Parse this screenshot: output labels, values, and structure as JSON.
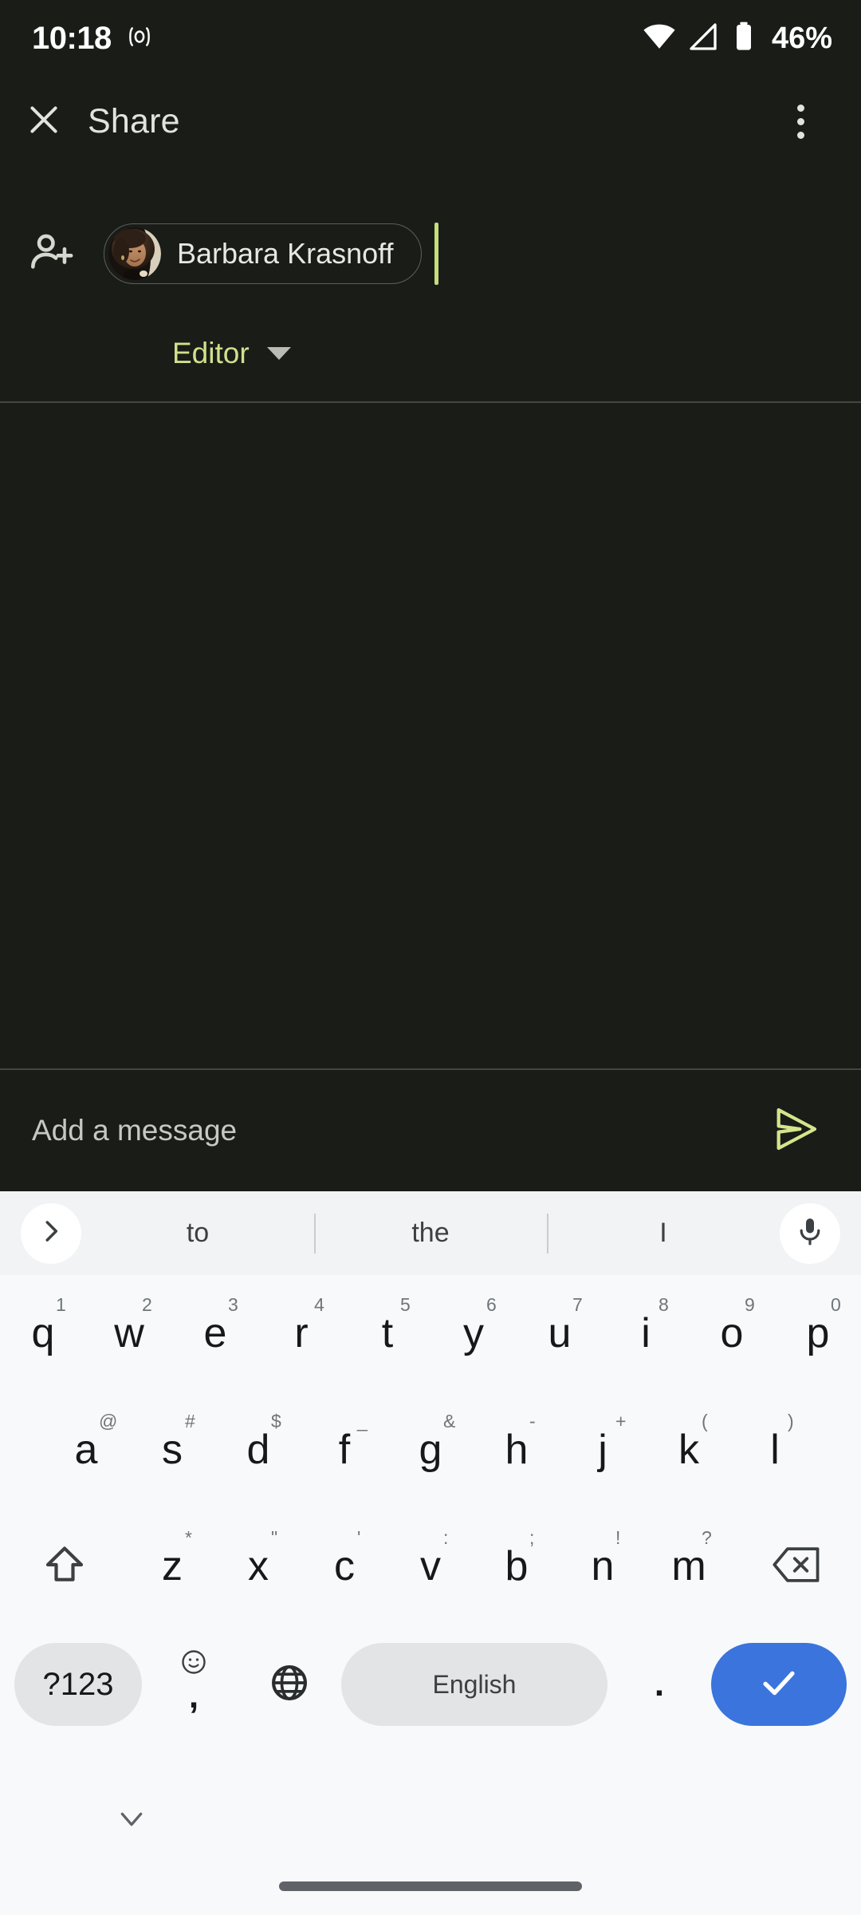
{
  "status_bar": {
    "clock": "10:18",
    "record_icon": "record-indicator-icon",
    "wifi_icon": "wifi-icon",
    "signal_icon": "cellular-signal-icon",
    "battery_icon": "battery-icon",
    "battery_percent": "46%"
  },
  "app_bar": {
    "close_icon": "close-icon",
    "title": "Share",
    "overflow_icon": "more-vert-icon"
  },
  "recipient": {
    "add_person_icon": "person-add-icon",
    "chip_name": "Barbara Krasnoff",
    "avatar_alt": "avatar",
    "caret_color": "#c6dd7c"
  },
  "role": {
    "label": "Editor",
    "caret_icon": "chevron-down-icon",
    "color": "#cfe18c"
  },
  "message": {
    "placeholder": "Add a message",
    "send_icon": "send-icon",
    "send_color": "#d4e58b"
  },
  "keyboard": {
    "expand_icon": "chevron-right-icon",
    "mic_icon": "microphone-icon",
    "suggestions": [
      "to",
      "the",
      "I"
    ],
    "row1": [
      {
        "key": "q",
        "alt": "1"
      },
      {
        "key": "w",
        "alt": "2"
      },
      {
        "key": "e",
        "alt": "3"
      },
      {
        "key": "r",
        "alt": "4"
      },
      {
        "key": "t",
        "alt": "5"
      },
      {
        "key": "y",
        "alt": "6"
      },
      {
        "key": "u",
        "alt": "7"
      },
      {
        "key": "i",
        "alt": "8"
      },
      {
        "key": "o",
        "alt": "9"
      },
      {
        "key": "p",
        "alt": "0"
      }
    ],
    "row2": [
      {
        "key": "a",
        "alt": "@"
      },
      {
        "key": "s",
        "alt": "#"
      },
      {
        "key": "d",
        "alt": "$"
      },
      {
        "key": "f",
        "alt": "_"
      },
      {
        "key": "g",
        "alt": "&"
      },
      {
        "key": "h",
        "alt": "-"
      },
      {
        "key": "j",
        "alt": "+"
      },
      {
        "key": "k",
        "alt": "("
      },
      {
        "key": "l",
        "alt": ")"
      }
    ],
    "row3": [
      {
        "key": "z",
        "alt": "*"
      },
      {
        "key": "x",
        "alt": "\""
      },
      {
        "key": "c",
        "alt": "'"
      },
      {
        "key": "v",
        "alt": ":"
      },
      {
        "key": "b",
        "alt": ";"
      },
      {
        "key": "n",
        "alt": "!"
      },
      {
        "key": "m",
        "alt": "?"
      }
    ],
    "shift_icon": "shift-icon",
    "backspace_icon": "backspace-icon",
    "num_key_label": "?123",
    "comma_key_label": ",",
    "emoji_icon": "emoji-smiley-icon",
    "globe_icon": "language-globe-icon",
    "space_key_label": "English",
    "period_key_label": ".",
    "enter_icon": "checkmark-icon",
    "enter_color": "#3b74dd"
  },
  "nav": {
    "hide_keyboard_icon": "chevron-down-icon",
    "home_indicator": "home-indicator"
  }
}
